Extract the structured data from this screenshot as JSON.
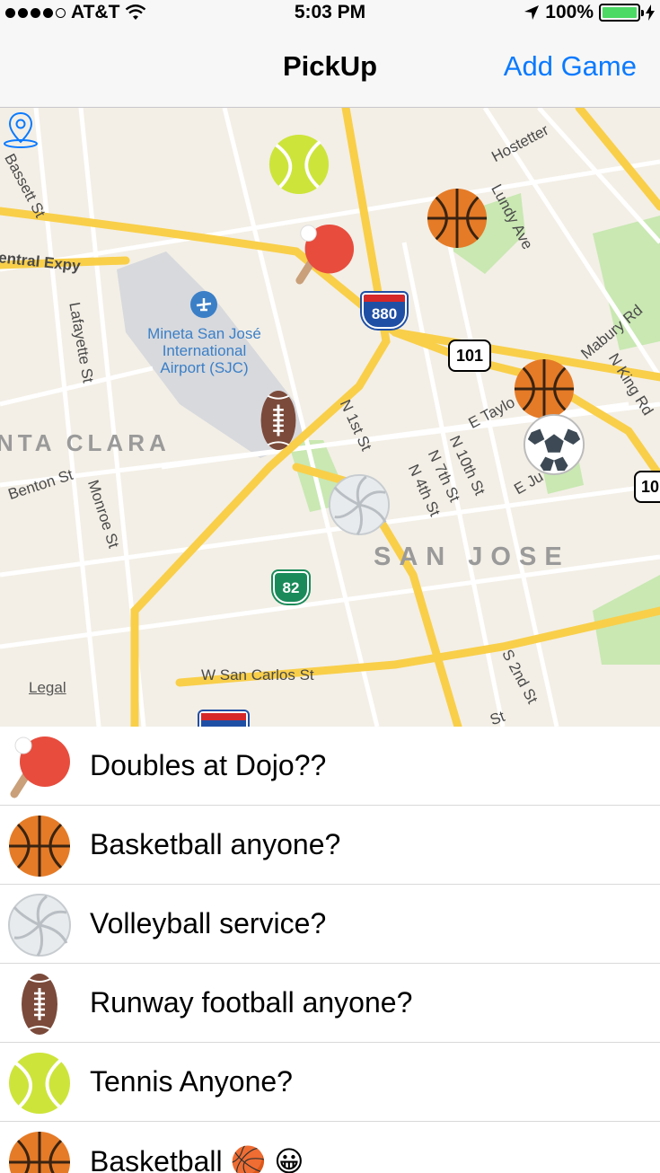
{
  "status": {
    "carrier": "AT&T",
    "time": "5:03 PM",
    "battery": "100%"
  },
  "nav": {
    "title": "PickUp",
    "action": "Add Game"
  },
  "map": {
    "labels": {
      "central": "entral Expy",
      "bassett": "Bassett St",
      "lafayette": "Lafayette St",
      "benton": "Benton St",
      "monroe": "Monroe St",
      "santa_clara": "NTA CLARA",
      "airport": "Mineta San José\nInternational\nAirport (SJC)",
      "hostetter": "Hostetter",
      "lundy": "Lundy Ave",
      "mabury": "Mabury Rd",
      "nking": "N King Rd",
      "n1st": "N 1st St",
      "etaylor": "E Taylo",
      "n10th": "N 10th St",
      "n7th": "N 7th St",
      "n4th": "N 4th St",
      "eju": "E Ju",
      "san_jose": "SAN JOSE",
      "wsancarlos": "W San Carlos St",
      "s2nd": "S 2nd St",
      "st": "St",
      "i880": "880",
      "us101": "101",
      "sr82": "82",
      "us10": "10",
      "legal": "Legal"
    },
    "pins": [
      "tennis",
      "ping-pong",
      "basketball",
      "basketball",
      "soccer",
      "football",
      "volleyball"
    ]
  },
  "games": [
    {
      "title": "Doubles at Dojo??",
      "sport": "ping-pong"
    },
    {
      "title": "Basketball anyone?",
      "sport": "basketball"
    },
    {
      "title": "Volleyball service?",
      "sport": "volleyball"
    },
    {
      "title": "Runway football anyone?",
      "sport": "football"
    },
    {
      "title": "Tennis Anyone?",
      "sport": "tennis"
    },
    {
      "title": "Basketball 🏀 😀",
      "sport": "basketball"
    }
  ],
  "colors": {
    "accent": "#0a7aff",
    "road_major": "#f9cf4a",
    "road_minor": "#ffffff",
    "map_bg": "#f3efe6",
    "park": "#c9e8b2",
    "airport": "#d7d9dd"
  }
}
